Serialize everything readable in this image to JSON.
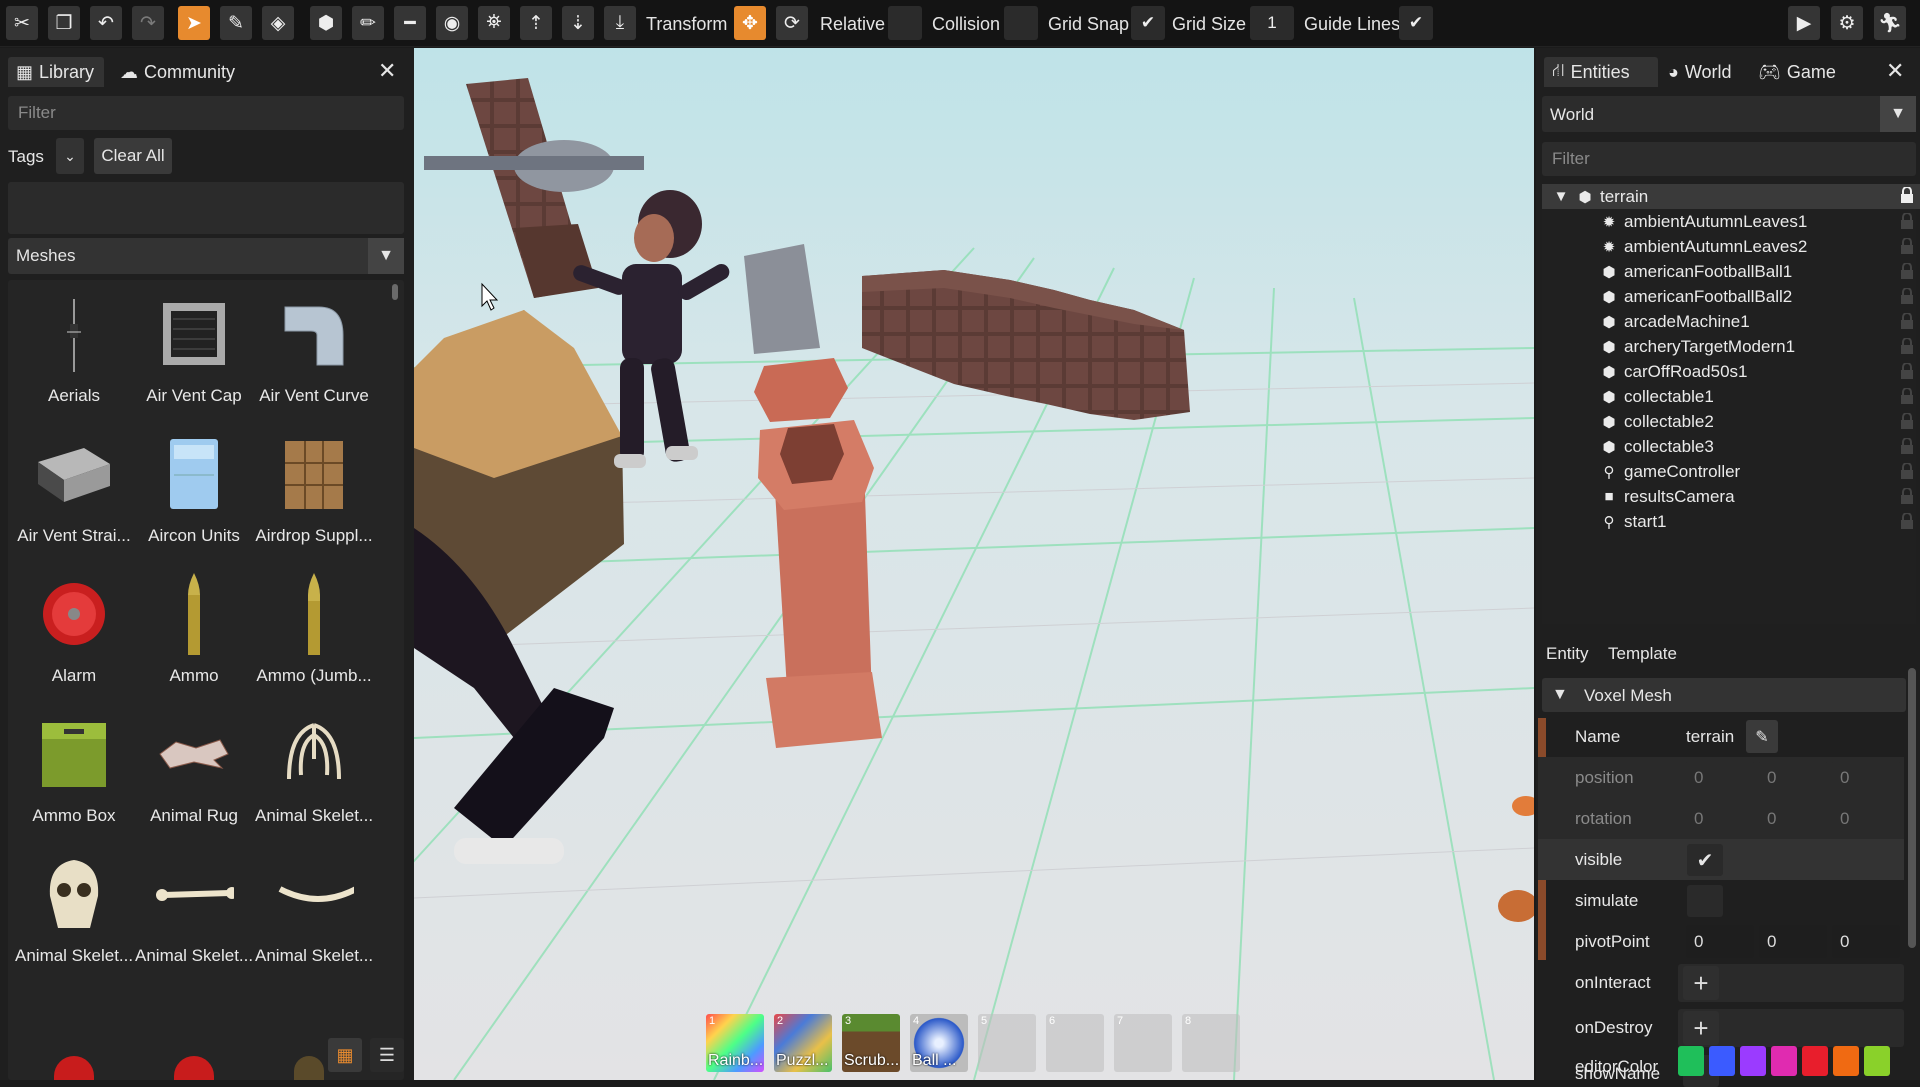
{
  "toolbar": {
    "transform_label": "Transform",
    "relative_label": "Relative",
    "collision_label": "Collision",
    "grid_snap_label": "Grid Snap",
    "grid_size_label": "Grid Size",
    "grid_size_value": "1",
    "guide_lines_label": "Guide Lines",
    "accent_color": "#e78a2e"
  },
  "library": {
    "tabs": [
      {
        "label": "Library",
        "icon": "grid-icon"
      },
      {
        "label": "Community",
        "icon": "cloud-icon"
      }
    ],
    "filter_placeholder": "Filter",
    "tags_label": "Tags",
    "clear_all_label": "Clear All",
    "category": "Meshes",
    "items": [
      {
        "label": "Aerials",
        "icon": "aerials-mesh"
      },
      {
        "label": "Air Vent Cap",
        "icon": "air-vent-cap-mesh"
      },
      {
        "label": "Air Vent Curve",
        "icon": "air-vent-curve-mesh"
      },
      {
        "label": "Air Vent Strai...",
        "icon": "air-vent-straight-mesh"
      },
      {
        "label": "Aircon Units",
        "icon": "aircon-mesh"
      },
      {
        "label": "Airdrop Suppl...",
        "icon": "airdrop-mesh"
      },
      {
        "label": "Alarm",
        "icon": "alarm-mesh"
      },
      {
        "label": "Ammo",
        "icon": "ammo-mesh"
      },
      {
        "label": "Ammo (Jumb...",
        "icon": "ammo-jumbo-mesh"
      },
      {
        "label": "Ammo Box",
        "icon": "ammo-box-mesh"
      },
      {
        "label": "Animal Rug",
        "icon": "animal-rug-mesh"
      },
      {
        "label": "Animal Skelet...",
        "icon": "ribcage-mesh"
      },
      {
        "label": "Animal Skelet...",
        "icon": "skull-mesh"
      },
      {
        "label": "Animal Skelet...",
        "icon": "bone-mesh"
      },
      {
        "label": "Animal Skelet...",
        "icon": "curved-bone-mesh"
      }
    ]
  },
  "hotbar": [
    {
      "num": "1",
      "name": "Rainb..."
    },
    {
      "num": "2",
      "name": "Puzzl..."
    },
    {
      "num": "3",
      "name": "Scrub..."
    },
    {
      "num": "4",
      "name": "Ball ..."
    },
    {
      "num": "5",
      "name": ""
    },
    {
      "num": "6",
      "name": ""
    },
    {
      "num": "7",
      "name": ""
    },
    {
      "num": "8",
      "name": ""
    }
  ],
  "entities": {
    "tabs": [
      {
        "label": "Entities",
        "icon": "hierarchy-icon"
      },
      {
        "label": "World",
        "icon": "globe-icon"
      },
      {
        "label": "Game",
        "icon": "gamepad-icon"
      }
    ],
    "scope_select": "World",
    "filter_placeholder": "Filter",
    "root": "terrain",
    "children": [
      {
        "label": "ambientAutumnLeaves1",
        "icon": "gear-icon"
      },
      {
        "label": "ambientAutumnLeaves2",
        "icon": "gear-icon"
      },
      {
        "label": "americanFootballBall1",
        "icon": "cube-icon"
      },
      {
        "label": "americanFootballBall2",
        "icon": "cube-icon"
      },
      {
        "label": "arcadeMachine1",
        "icon": "cube-icon"
      },
      {
        "label": "archeryTargetModern1",
        "icon": "cube-icon"
      },
      {
        "label": "carOffRoad50s1",
        "icon": "cube-icon"
      },
      {
        "label": "collectable1",
        "icon": "cube-icon"
      },
      {
        "label": "collectable2",
        "icon": "cube-icon"
      },
      {
        "label": "collectable3",
        "icon": "cube-icon"
      },
      {
        "label": "gameController",
        "icon": "pin-icon"
      },
      {
        "label": "resultsCamera",
        "icon": "camera-icon"
      },
      {
        "label": "start1",
        "icon": "pin-icon"
      }
    ]
  },
  "inspector": {
    "tabs": [
      "Entity",
      "Template"
    ],
    "section": "Voxel Mesh",
    "name_label": "Name",
    "name_value": "terrain",
    "position_label": "position",
    "position": [
      "0",
      "0",
      "0"
    ],
    "rotation_label": "rotation",
    "rotation": [
      "0",
      "0",
      "0"
    ],
    "visible_label": "visible",
    "visible": true,
    "simulate_label": "simulate",
    "simulate": false,
    "pivot_label": "pivotPoint",
    "pivot": [
      "0",
      "0",
      "0"
    ],
    "on_interact_label": "onInteract",
    "on_destroy_label": "onDestroy",
    "show_name_label": "showName",
    "show_name": false,
    "editor_color_label": "editorColor",
    "editor_colors": [
      "#1fbf5a",
      "#3b5bff",
      "#9b3bff",
      "#e02bb0",
      "#e81e2c",
      "#f06a12",
      "#8ad12a"
    ]
  }
}
